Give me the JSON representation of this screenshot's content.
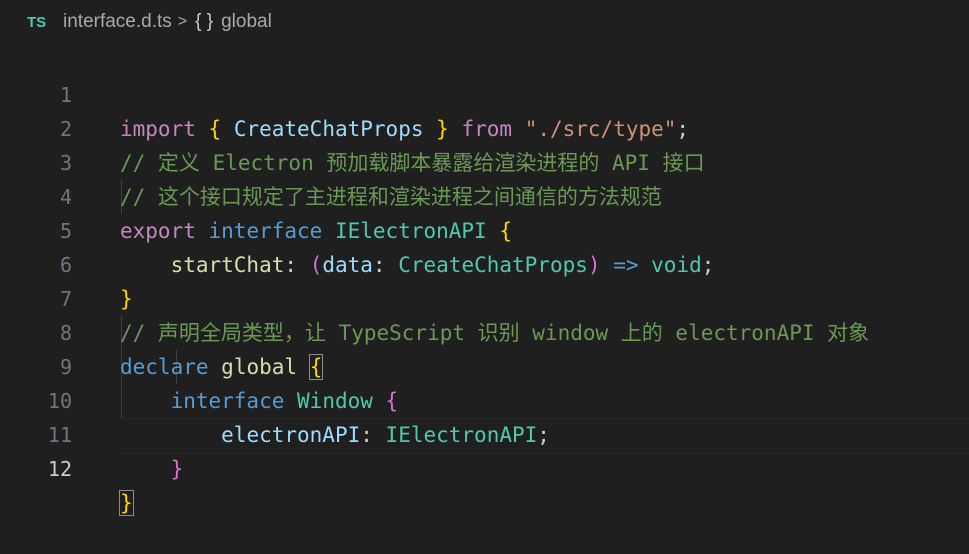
{
  "breadcrumb": {
    "file_badge": "TS",
    "file_name": "interface.d.ts",
    "separator": ">",
    "symbol_icon": "{ }",
    "symbol_name": "global"
  },
  "line_numbers": [
    "1",
    "2",
    "3",
    "4",
    "5",
    "6",
    "7",
    "8",
    "9",
    "10",
    "11",
    "12"
  ],
  "code": {
    "l1": {
      "import": "import",
      "ob": "{",
      "name": "CreateChatProps",
      "cb": "}",
      "from": "from",
      "path": "\"./src/type\"",
      "semi": ";"
    },
    "l2": {
      "comment": "// 定义 Electron 预加载脚本暴露给渲染进程的 API 接口"
    },
    "l3": {
      "comment": "// 这个接口规定了主进程和渲染进程之间通信的方法规范"
    },
    "l4": {
      "export": "export",
      "interface": "interface",
      "name": "IElectronAPI",
      "ob": "{"
    },
    "l5": {
      "prop": "startChat",
      "colon": ":",
      "op": "(",
      "param": "data",
      "colon2": ":",
      "ptype": "CreateChatProps",
      "cp": ")",
      "arrow": "=>",
      "ret": "void",
      "semi": ";"
    },
    "l6": {
      "cb": "}"
    },
    "l7": {
      "comment": "// 声明全局类型，让 TypeScript 识别 window 上的 electronAPI 对象"
    },
    "l8": {
      "declare": "declare",
      "global": "global",
      "ob": "{"
    },
    "l9": {
      "interface": "interface",
      "name": "Window",
      "ob": "{"
    },
    "l10": {
      "prop": "electronAPI",
      "colon": ":",
      "type": "IElectronAPI",
      "semi": ";"
    },
    "l11": {
      "cb": "}"
    },
    "l12": {
      "cb": "}"
    }
  }
}
